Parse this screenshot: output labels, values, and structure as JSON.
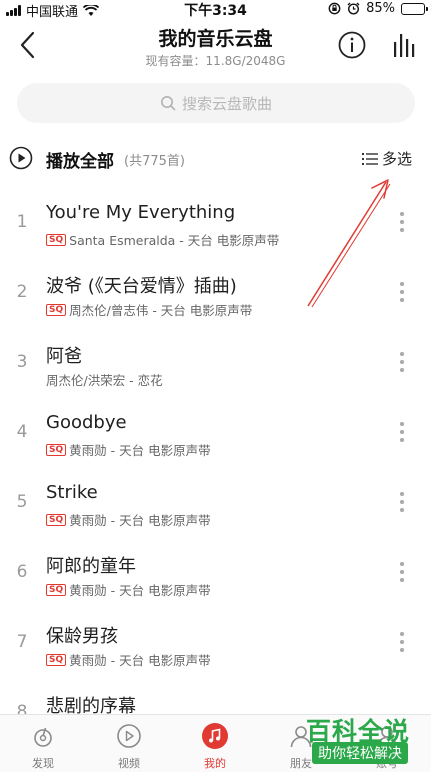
{
  "status_bar": {
    "carrier": "中国联通",
    "time": "下午3:34",
    "battery": "85%",
    "battery_level": 0.85
  },
  "header": {
    "title": "我的音乐云盘",
    "capacity_label": "现有容量：11.8G/2048G"
  },
  "search": {
    "placeholder": "搜索云盘歌曲"
  },
  "play_all": {
    "label": "播放全部",
    "count": "(共775首)",
    "multi_select": "多选"
  },
  "songs": [
    {
      "num": "1",
      "title": "You're My Everything",
      "sq": "SQ",
      "subtitle": "Santa Esmeralda - 天台 电影原声带"
    },
    {
      "num": "2",
      "title": "波爷 (《天台爱情》插曲)",
      "sq": "SQ",
      "subtitle": "周杰伦/曾志伟 - 天台 电影原声带"
    },
    {
      "num": "3",
      "title": "阿爸",
      "sq": "",
      "subtitle": "周杰伦/洪荣宏 - 恋花"
    },
    {
      "num": "4",
      "title": "Goodbye",
      "sq": "SQ",
      "subtitle": "黄雨勋 - 天台 电影原声带"
    },
    {
      "num": "5",
      "title": "Strike",
      "sq": "SQ",
      "subtitle": "黄雨勋 - 天台 电影原声带"
    },
    {
      "num": "6",
      "title": "阿郎的童年",
      "sq": "SQ",
      "subtitle": "黄雨勋 - 天台 电影原声带"
    },
    {
      "num": "7",
      "title": "保龄男孩",
      "sq": "SQ",
      "subtitle": "黄雨勋 - 天台 电影原声带"
    },
    {
      "num": "8",
      "title": "悲剧的序幕",
      "sq": "",
      "subtitle": ""
    }
  ],
  "tabs": [
    {
      "label": "发现",
      "icon": "discover-icon"
    },
    {
      "label": "视频",
      "icon": "video-icon"
    },
    {
      "label": "我的",
      "icon": "my-music-icon"
    },
    {
      "label": "朋友",
      "icon": "friends-icon"
    },
    {
      "label": "账号",
      "icon": "account-icon"
    }
  ],
  "watermark": {
    "top": "百科全说",
    "bottom": "助你轻松解决"
  },
  "colors": {
    "accent": "#e03a32",
    "watermark": "#2aa84a",
    "annotation": "#e03a32"
  }
}
